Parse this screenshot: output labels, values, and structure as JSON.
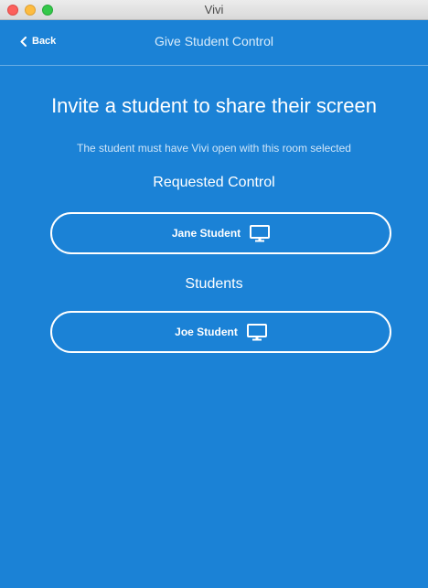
{
  "window": {
    "title": "Vivi"
  },
  "navbar": {
    "back_label": "Back",
    "title": "Give Student Control"
  },
  "main": {
    "heading": "Invite a student to share their screen",
    "subheading": "The student must have Vivi open with this room selected",
    "requested_label": "Requested Control",
    "requested_students": [
      {
        "name": "Jane Student",
        "icon": "monitor-icon"
      }
    ],
    "students_label": "Students",
    "students": [
      {
        "name": "Joe Student",
        "icon": "monitor-icon"
      }
    ]
  },
  "colors": {
    "background": "#1b82d6",
    "text": "#ffffff"
  }
}
